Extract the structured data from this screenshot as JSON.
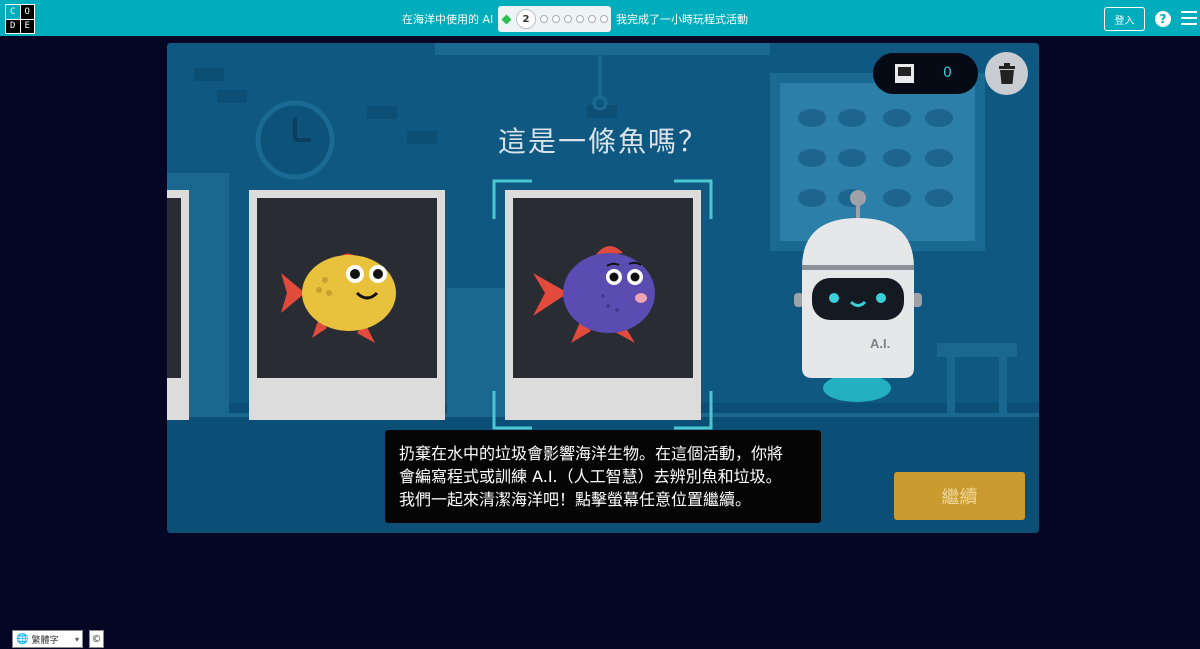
{
  "header": {
    "logo_letters": [
      "C",
      "O",
      "D",
      "E"
    ],
    "activity_title": "在海洋中使用的 AI",
    "progress": {
      "current_level": "2",
      "total_levels": 8
    },
    "completed_text": "我完成了一小時玩程式活動",
    "signin_label": "登入",
    "help_icon": "?"
  },
  "stage": {
    "question": "這是一條魚嗎？",
    "counter_value": "0",
    "robot_label": "A.I.",
    "caption_lines": [
      "扔棄在水中的垃圾會影響海洋生物。在這個活動，你將",
      "會編寫程式或訓練 A.I.（人工智慧）去辨別魚和垃圾。",
      "我們一起來清潔海洋吧！點擊螢幕任意位置繼續。"
    ],
    "continue_label": "繼續"
  },
  "footer": {
    "language": "繁體字",
    "copyright_icon": "©"
  },
  "colors": {
    "header": "#00adbc",
    "page_bg": "#050624",
    "stage_bg": "#0f5b84",
    "continue": "#c99a2e",
    "accent": "#3ad0da"
  }
}
